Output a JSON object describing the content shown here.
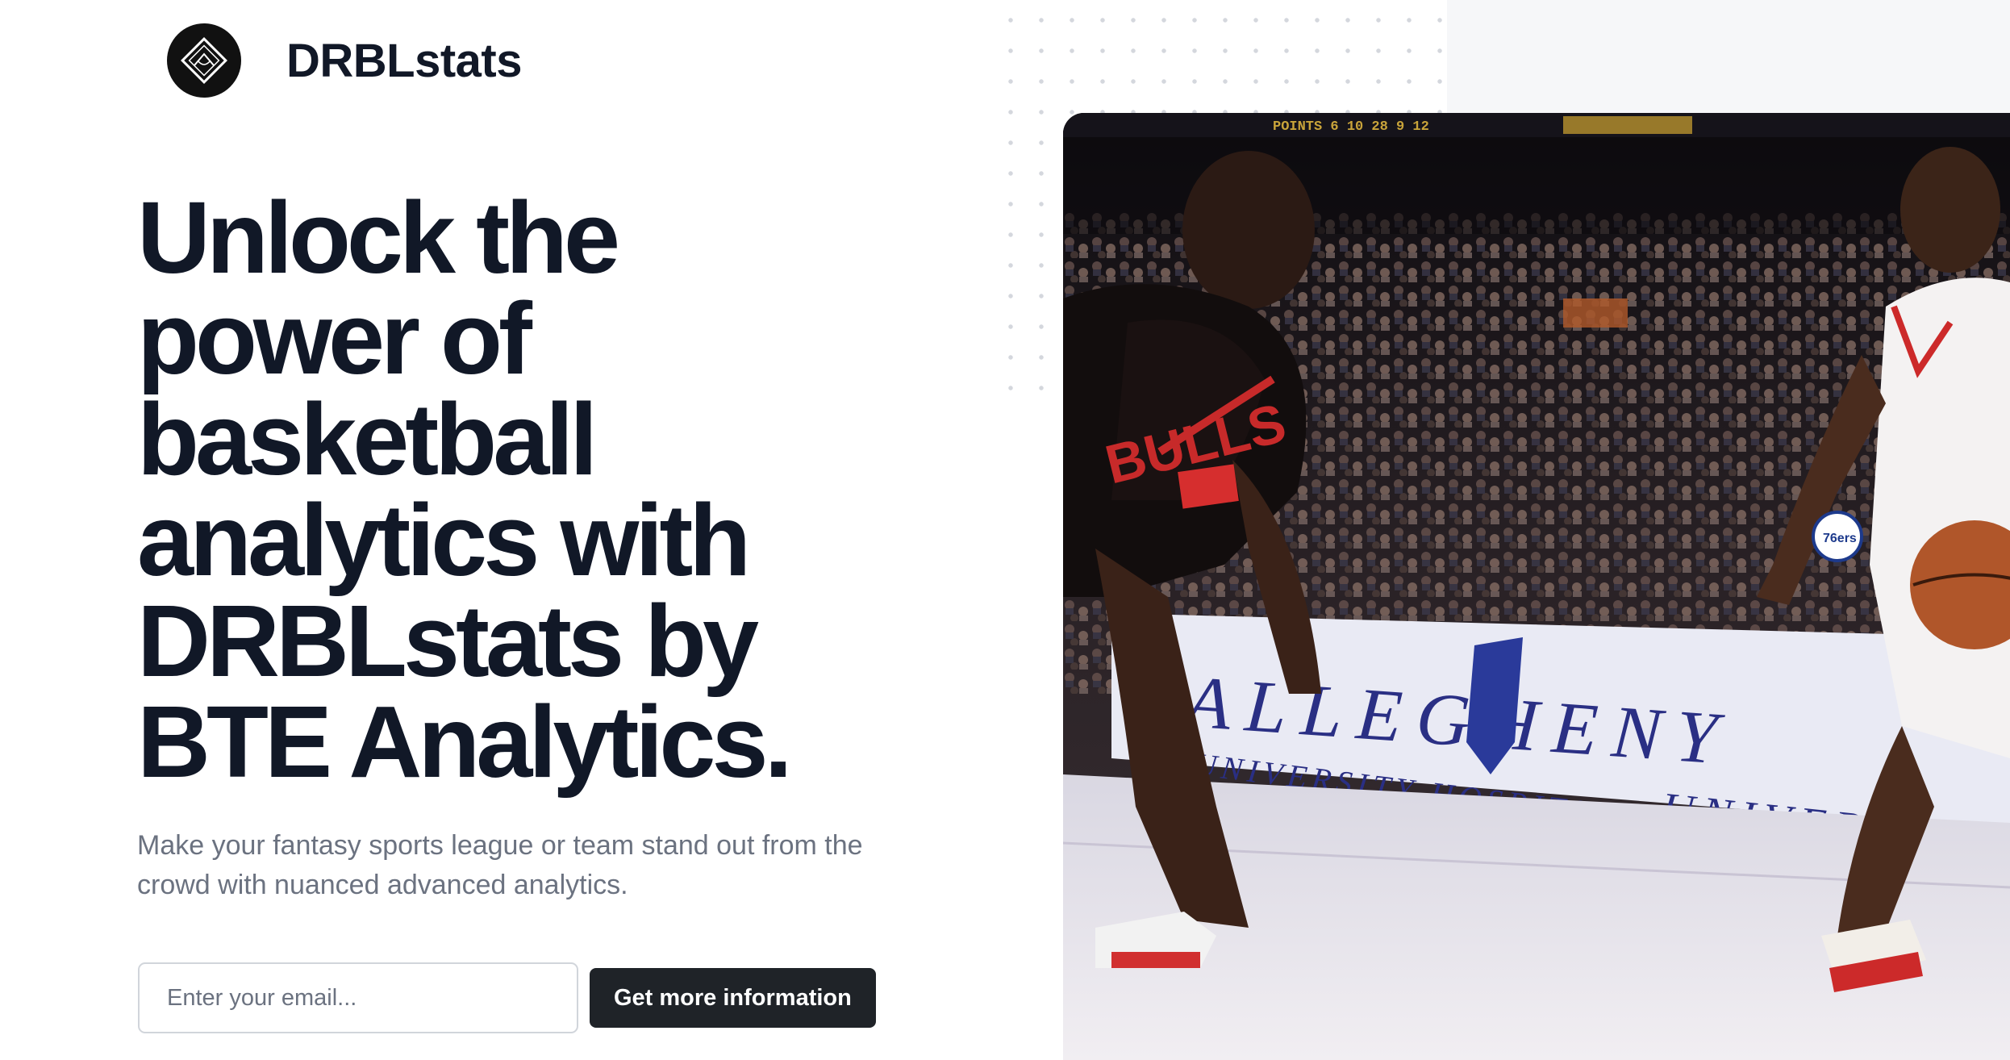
{
  "brand": {
    "name": "DRBLstats",
    "logo_icon": "diamond-court-logo-icon"
  },
  "hero": {
    "title_lines": [
      "Unlock the",
      "power of",
      "basketball",
      "analytics with",
      "DRBLstats by",
      "BTE Analytics."
    ],
    "subtitle_lines": [
      "Make your fantasy sports league or team stand out from the",
      "crowd with nuanced advanced analytics."
    ]
  },
  "form": {
    "email_placeholder": "Enter your email...",
    "submit_label": "Get more information"
  },
  "photo": {
    "alt": "Two basketball players on court",
    "scoreboard_text": "POINTS  6  10  28  9  12",
    "jersey_text": "BULLS",
    "banner_text": "ALLEGHENY",
    "banner_subtext": "UNIVERSITY HOSPITALS",
    "banner_text_right": "UNIVERSITY",
    "sixers_badge": "76ers"
  },
  "colors": {
    "text_primary": "#111827",
    "text_secondary": "#6b7280",
    "button_bg": "#1f2328",
    "input_border": "#d1d5db",
    "dot_color": "#d4d7dd"
  }
}
